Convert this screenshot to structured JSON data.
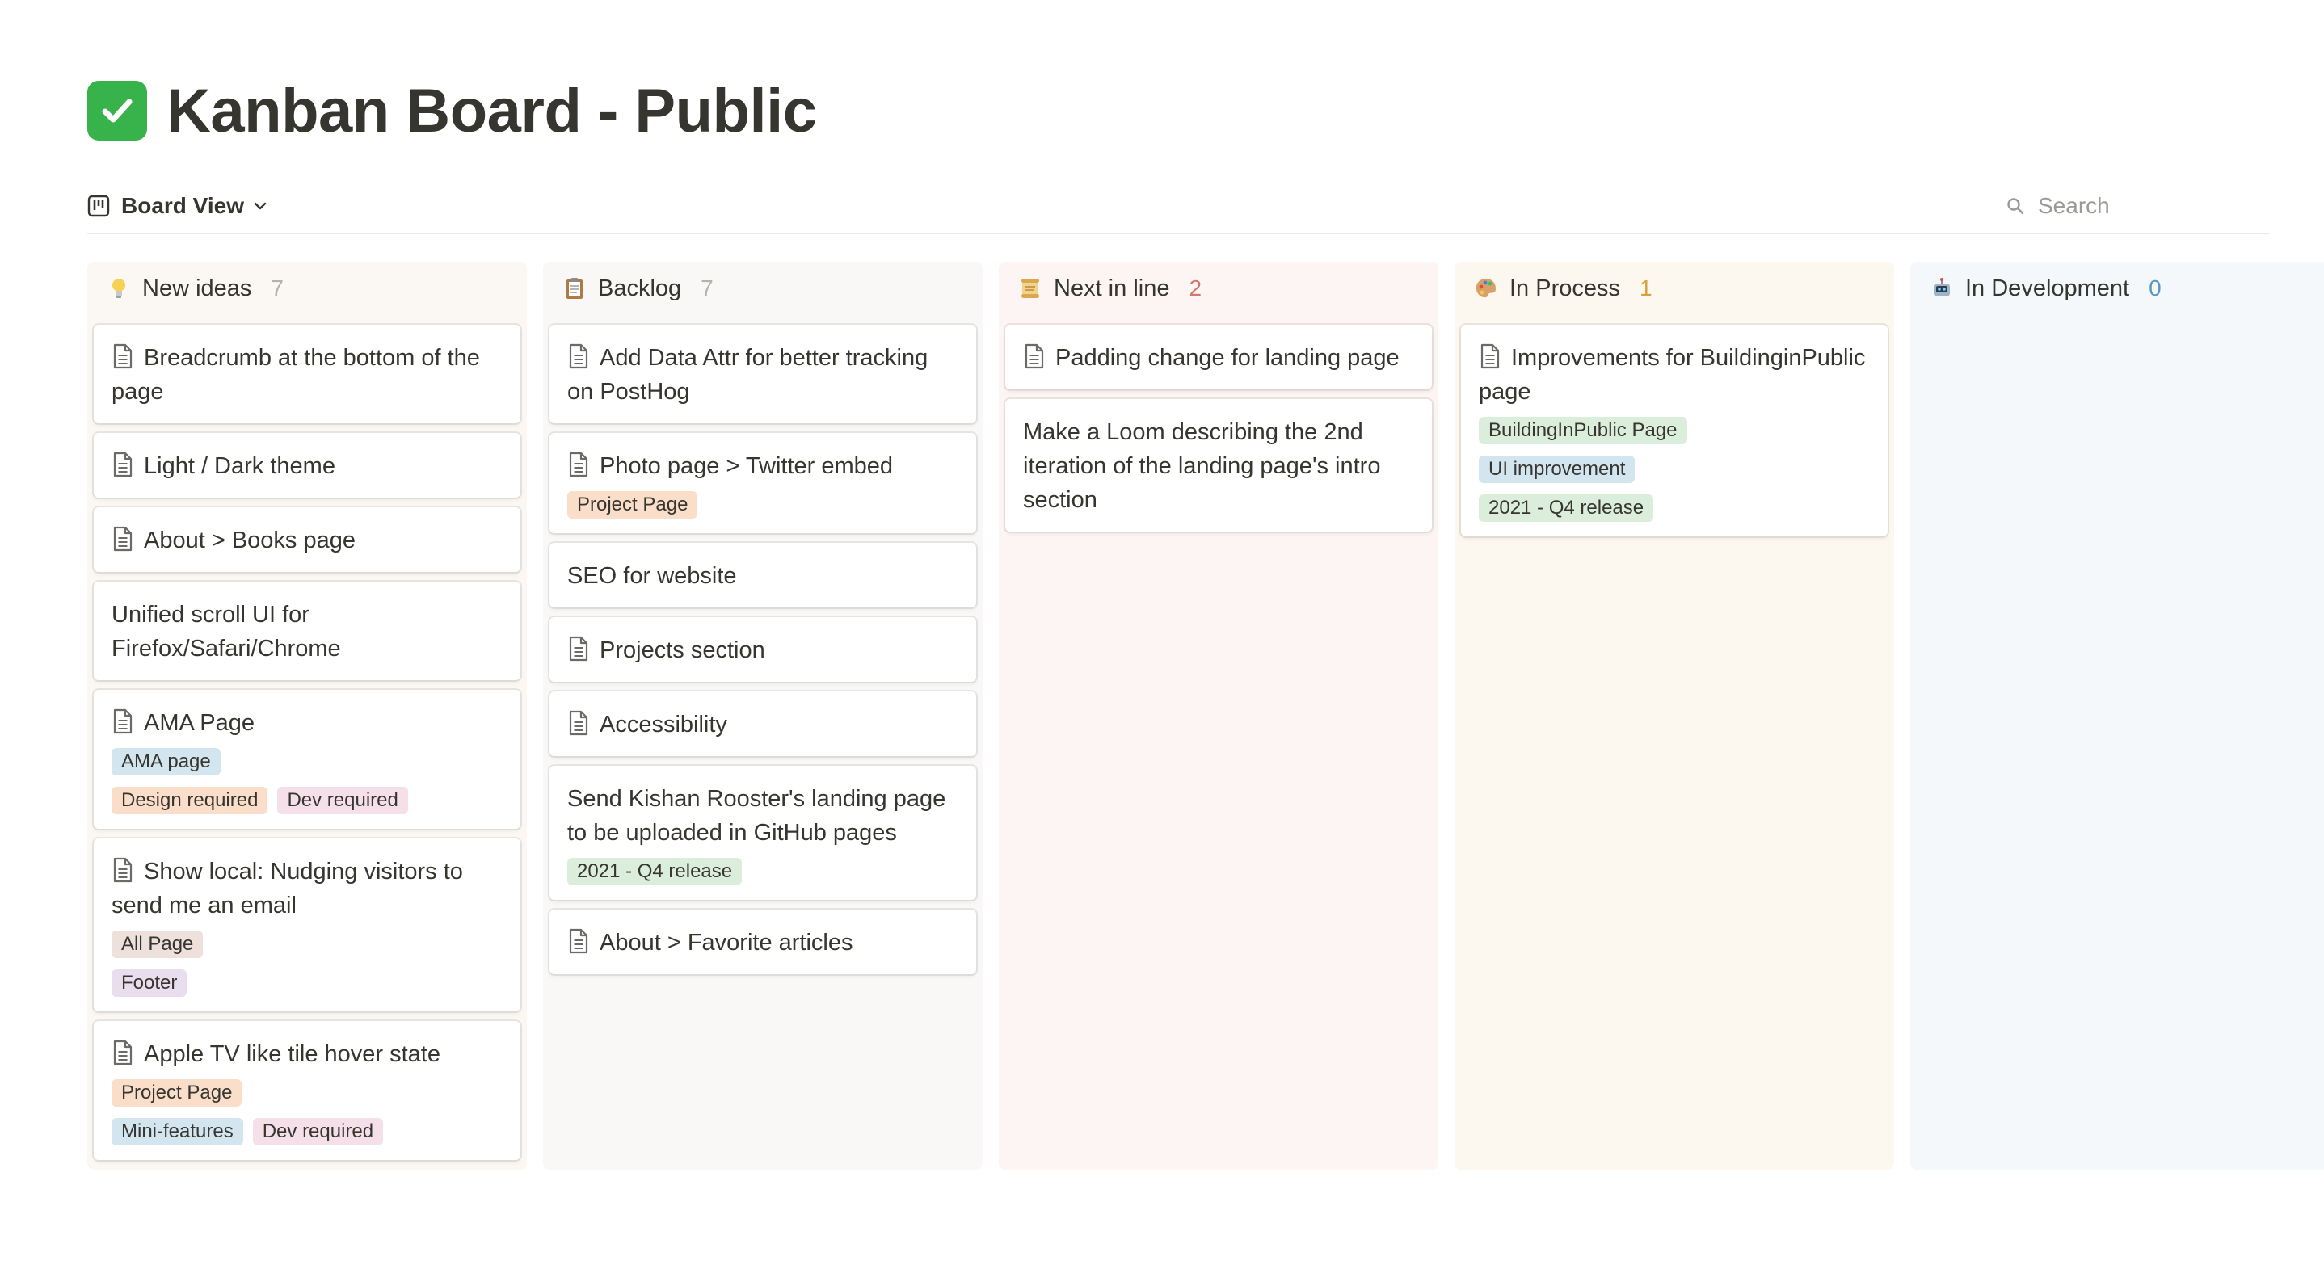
{
  "page": {
    "title": "Kanban Board - Public",
    "title_icon": "check-mark-button-icon"
  },
  "toolbar": {
    "view_label": "Board View",
    "search_placeholder": "Search"
  },
  "colors": {
    "tag_orange": "#fadec9",
    "tag_blue": "#d3e5ef",
    "tag_pink": "#f5e0e9",
    "tag_brown": "#eee0da",
    "tag_purple": "#e8deee",
    "tag_green": "#dbeddb"
  },
  "columns": [
    {
      "title": "New ideas",
      "count": "7",
      "emoji": "light-bulb-icon",
      "bg": "#fbf8f3",
      "count_color": "#b4b2ad",
      "cards": [
        {
          "title": "Breadcrumb at the bottom of the page",
          "doc_icon": true,
          "tag_lines": []
        },
        {
          "title": "Light / Dark theme",
          "doc_icon": true,
          "tag_lines": []
        },
        {
          "title": "About > Books page",
          "doc_icon": true,
          "tag_lines": []
        },
        {
          "title": "Unified scroll UI for Firefox/Safari/Chrome",
          "doc_icon": false,
          "tag_lines": []
        },
        {
          "title": "AMA Page",
          "doc_icon": true,
          "tag_lines": [
            [
              {
                "label": "AMA page",
                "color": "blue"
              }
            ],
            [
              {
                "label": "Design required",
                "color": "orange"
              },
              {
                "label": "Dev required",
                "color": "pink"
              }
            ]
          ]
        },
        {
          "title": "Show local: Nudging visitors to send me an email",
          "doc_icon": true,
          "tag_lines": [
            [
              {
                "label": "All Page",
                "color": "brown"
              }
            ],
            [
              {
                "label": "Footer",
                "color": "purple"
              }
            ]
          ]
        },
        {
          "title": "Apple TV like tile hover state",
          "doc_icon": true,
          "tag_lines": [
            [
              {
                "label": "Project Page",
                "color": "orange"
              }
            ],
            [
              {
                "label": "Mini-features",
                "color": "blue"
              },
              {
                "label": "Dev required",
                "color": "pink"
              }
            ]
          ]
        }
      ]
    },
    {
      "title": "Backlog",
      "count": "7",
      "emoji": "clipboard-icon",
      "bg": "#f9f8f7",
      "count_color": "#b4b2ad",
      "cards": [
        {
          "title": "Add Data Attr for better tracking on PostHog",
          "doc_icon": true,
          "tag_lines": []
        },
        {
          "title": "Photo page > Twitter embed",
          "doc_icon": true,
          "tag_lines": [
            [
              {
                "label": "Project Page",
                "color": "orange"
              }
            ]
          ]
        },
        {
          "title": "SEO for website",
          "doc_icon": false,
          "tag_lines": []
        },
        {
          "title": "Projects section",
          "doc_icon": true,
          "tag_lines": []
        },
        {
          "title": "Accessibility",
          "doc_icon": true,
          "tag_lines": []
        },
        {
          "title": "Send Kishan Rooster's landing page to be uploaded in GitHub pages",
          "doc_icon": false,
          "tag_lines": [
            [
              {
                "label": "2021 - Q4 release",
                "color": "green"
              }
            ]
          ]
        },
        {
          "title": "About > Favorite articles",
          "doc_icon": true,
          "tag_lines": []
        }
      ]
    },
    {
      "title": "Next in line",
      "count": "2",
      "emoji": "scroll-icon",
      "bg": "#fdf5f3",
      "count_color": "#d4766c",
      "cards": [
        {
          "title": "Padding change for landing page",
          "doc_icon": true,
          "tag_lines": []
        },
        {
          "title": "Make a Loom describing the 2nd iteration of the landing page's intro section",
          "doc_icon": false,
          "tag_lines": []
        }
      ]
    },
    {
      "title": "In Process",
      "count": "1",
      "emoji": "palette-icon",
      "bg": "#fcf7ef",
      "count_color": "#d9a13b",
      "cards": [
        {
          "title": "Improvements for BuildinginPublic page",
          "doc_icon": true,
          "tag_lines": [
            [
              {
                "label": "BuildingInPublic Page",
                "color": "green"
              }
            ],
            [
              {
                "label": "UI improvement",
                "color": "blue"
              }
            ],
            [
              {
                "label": "2021 - Q4 release",
                "color": "green"
              }
            ]
          ]
        }
      ]
    },
    {
      "title": "In Development",
      "count": "0",
      "emoji": "robot-icon",
      "bg": "#f4f8fb",
      "count_color": "#5b97bd",
      "cards": []
    }
  ]
}
